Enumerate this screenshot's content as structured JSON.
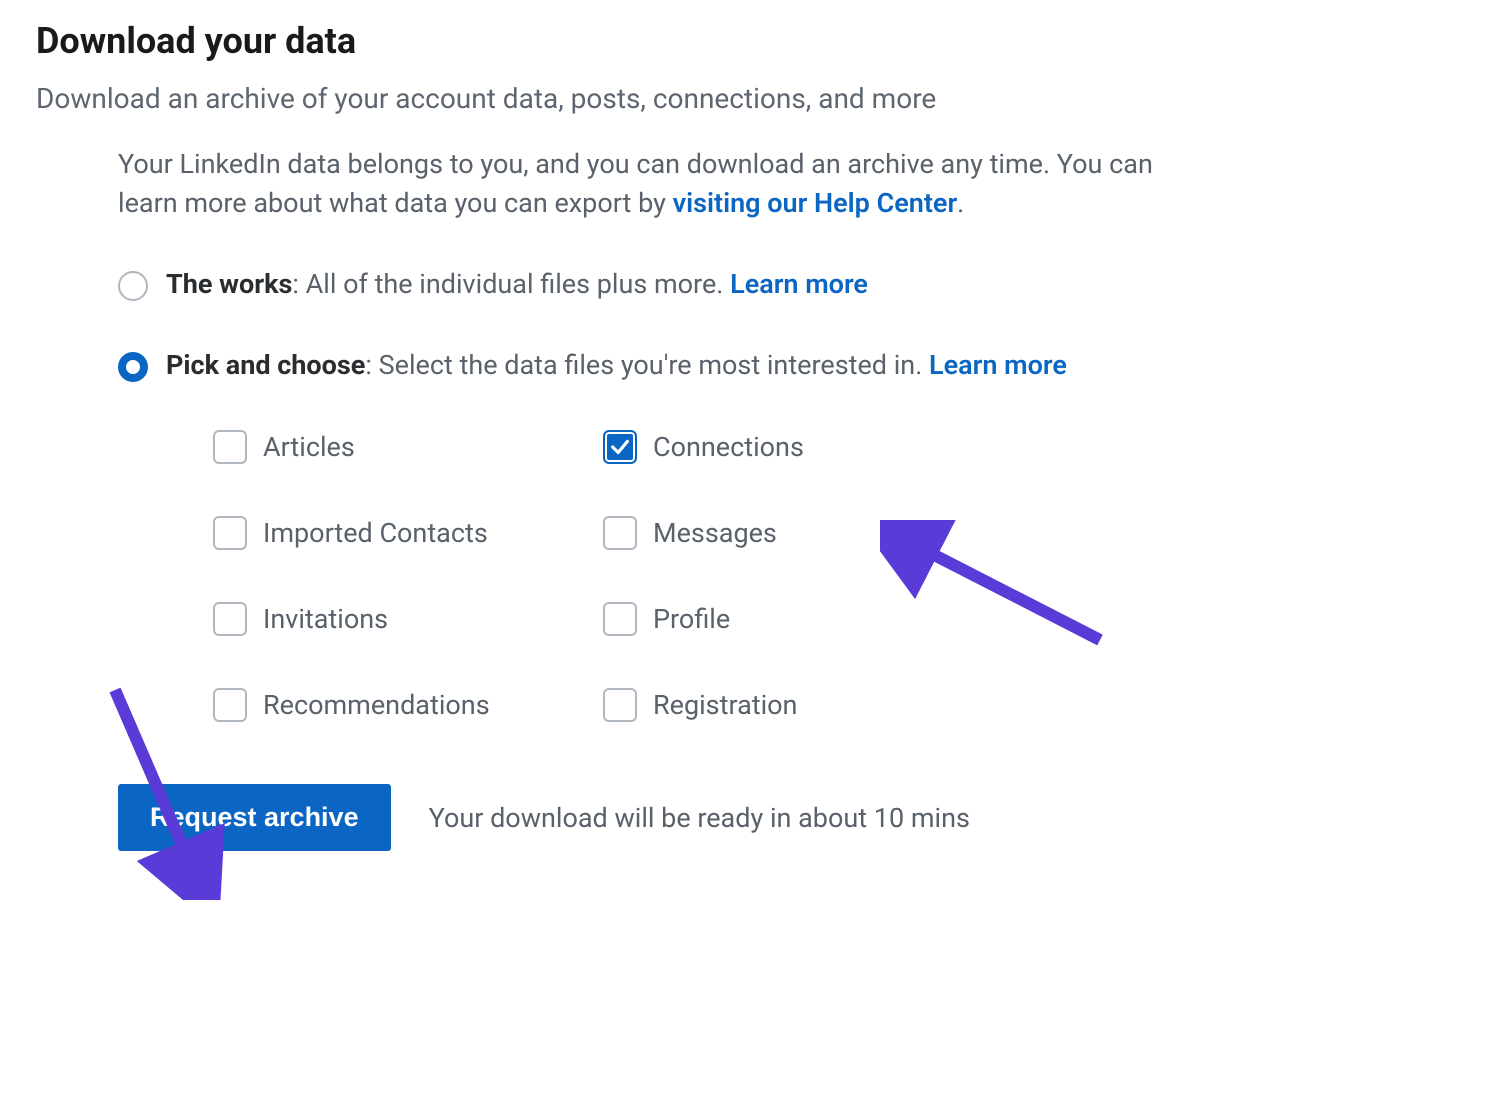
{
  "header": {
    "title": "Download your data",
    "subtitle": "Download an archive of your account data, posts, connections, and more"
  },
  "info": {
    "paragraph_prefix": "Your LinkedIn data belongs to you, and you can download an archive any time. You can learn more about what data you can export by ",
    "help_link": "visiting our Help Center",
    "paragraph_suffix": "."
  },
  "options": {
    "works": {
      "bold": "The works",
      "text": ": All of the individual files plus more. ",
      "learn_more": "Learn more",
      "selected": false
    },
    "pick": {
      "bold": "Pick and choose",
      "text": ": Select the data files you're most interested in. ",
      "learn_more": "Learn more",
      "selected": true
    }
  },
  "checkboxes": [
    {
      "key": "articles",
      "label": "Articles",
      "checked": false
    },
    {
      "key": "connections",
      "label": "Connections",
      "checked": true
    },
    {
      "key": "imported-contacts",
      "label": "Imported Contacts",
      "checked": false
    },
    {
      "key": "messages",
      "label": "Messages",
      "checked": false
    },
    {
      "key": "invitations",
      "label": "Invitations",
      "checked": false
    },
    {
      "key": "profile",
      "label": "Profile",
      "checked": false
    },
    {
      "key": "recommendations",
      "label": "Recommendations",
      "checked": false
    },
    {
      "key": "registration",
      "label": "Registration",
      "checked": false
    }
  ],
  "action": {
    "button": "Request archive",
    "ready_text": "Your download will be ready in about 10 mins"
  },
  "colors": {
    "link_blue": "#0a66c2",
    "arrow_purple": "#5B3BD8"
  }
}
